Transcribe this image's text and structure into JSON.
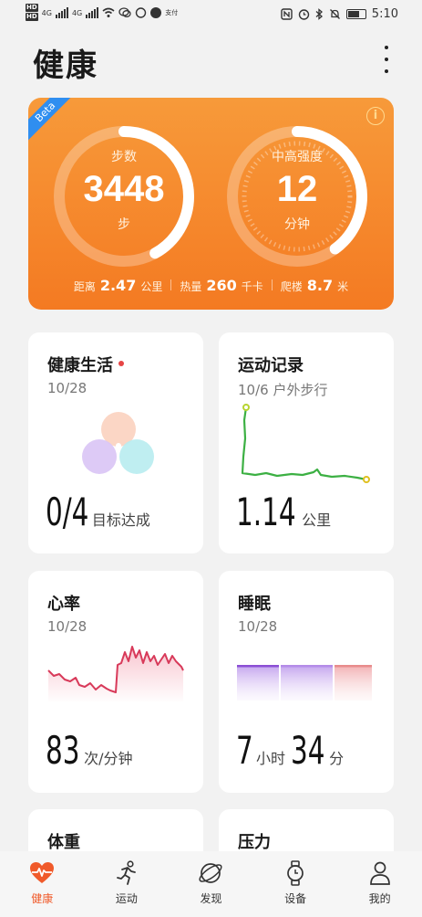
{
  "status_bar": {
    "left_labels": [
      "HD",
      "HD"
    ],
    "net_labels": [
      "4G",
      "4G"
    ],
    "carrier_note": "支付",
    "time": "5:10"
  },
  "header": {
    "title": "健康"
  },
  "hero": {
    "beta_label": "Beta",
    "steps": {
      "label": "步数",
      "value": "3448",
      "unit": "步",
      "progress": 0.42
    },
    "intensity": {
      "label": "中高强度",
      "value": "12",
      "unit": "分钟",
      "progress": 0.4
    },
    "stats": [
      {
        "label": "距离",
        "value": "2.47",
        "unit": "公里"
      },
      {
        "label": "热量",
        "value": "260",
        "unit": "千卡"
      },
      {
        "label": "爬楼",
        "value": "8.7",
        "unit": "米"
      }
    ]
  },
  "cards": {
    "healthy_life": {
      "title": "健康生活",
      "date": "10/28",
      "value": "0/4",
      "unit": "目标达成"
    },
    "exercise": {
      "title": "运动记录",
      "date": "10/6 户外步行",
      "value": "1.14",
      "unit": "公里"
    },
    "heart_rate": {
      "title": "心率",
      "date": "10/28",
      "value": "83",
      "unit": "次/分钟"
    },
    "sleep": {
      "title": "睡眠",
      "date": "10/28",
      "hours": "7",
      "hours_unit": "小时",
      "minutes": "34",
      "minutes_unit": "分"
    },
    "weight": {
      "title": "体重"
    },
    "stress": {
      "title": "压力"
    }
  },
  "tabs": [
    {
      "label": "健康",
      "icon": "heart-pulse-icon",
      "active": true
    },
    {
      "label": "运动",
      "icon": "running-icon",
      "active": false
    },
    {
      "label": "发现",
      "icon": "planet-icon",
      "active": false
    },
    {
      "label": "设备",
      "icon": "watch-icon",
      "active": false
    },
    {
      "label": "我的",
      "icon": "person-icon",
      "active": false
    }
  ],
  "colors": {
    "accent": "#f05a2a",
    "hero_top": "#f79a3a",
    "hero_bottom": "#f47a22",
    "beta": "#2f8ef0",
    "heart_line": "#d83a5a",
    "route": "#3cb043"
  }
}
